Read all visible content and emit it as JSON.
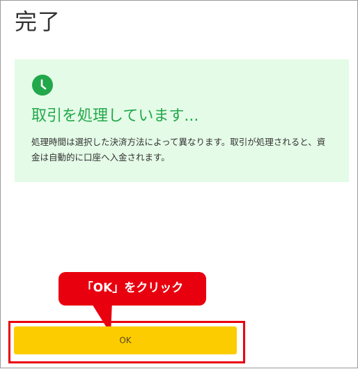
{
  "page": {
    "title": "完了"
  },
  "status": {
    "icon": "clock-icon",
    "heading": "取引を処理しています...",
    "description": "処理時間は選択した決済方法によって異なります。取引が処理されると、資金は自動的に口座へ入金されます。",
    "accent_color": "#22a84a",
    "background_color": "#e4fbe7"
  },
  "annotation": {
    "callout_text": "「OK」をクリック",
    "color": "#e8000f"
  },
  "actions": {
    "ok_label": "OK",
    "ok_color": "#fccc00"
  }
}
